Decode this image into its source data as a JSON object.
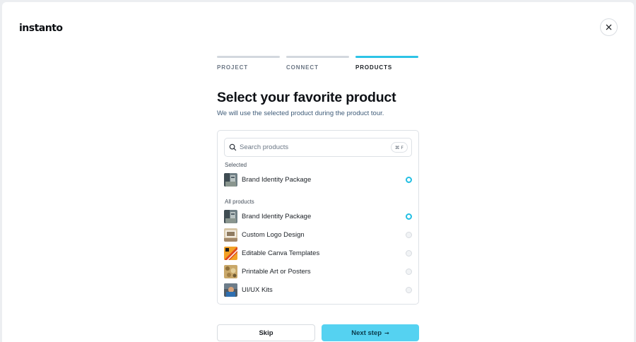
{
  "brand": {
    "logo_text": "instanto"
  },
  "stepper": {
    "steps": [
      {
        "label": "PROJECT",
        "state": "done"
      },
      {
        "label": "CONNECT",
        "state": "done"
      },
      {
        "label": "PRODUCTS",
        "state": "active"
      }
    ],
    "accent_color": "#2dc3e6"
  },
  "heading": {
    "title": "Select your favorite product",
    "subtitle": "We will use the selected product during the product tour."
  },
  "search": {
    "placeholder": "Search products",
    "value": "",
    "shortcut": "⌘ F"
  },
  "selected_section": {
    "label": "Selected",
    "items": [
      {
        "label": "Brand Identity Package",
        "checked": true,
        "thumb": "brand-identity"
      }
    ]
  },
  "all_section": {
    "label": "All products",
    "items": [
      {
        "label": "Brand Identity Package",
        "checked": true,
        "thumb": "brand-identity"
      },
      {
        "label": "Custom Logo Design",
        "checked": false,
        "thumb": "logo-design"
      },
      {
        "label": "Editable Canva Templates",
        "checked": false,
        "thumb": "canva-templates"
      },
      {
        "label": "Printable Art or Posters",
        "checked": false,
        "thumb": "printable-art"
      },
      {
        "label": "UI/UX Kits",
        "checked": false,
        "thumb": "uiux-kits"
      }
    ]
  },
  "actions": {
    "skip_label": "Skip",
    "next_label": "Next step",
    "next_icon": "arrow-right-icon",
    "next_color": "#55d2f1"
  }
}
